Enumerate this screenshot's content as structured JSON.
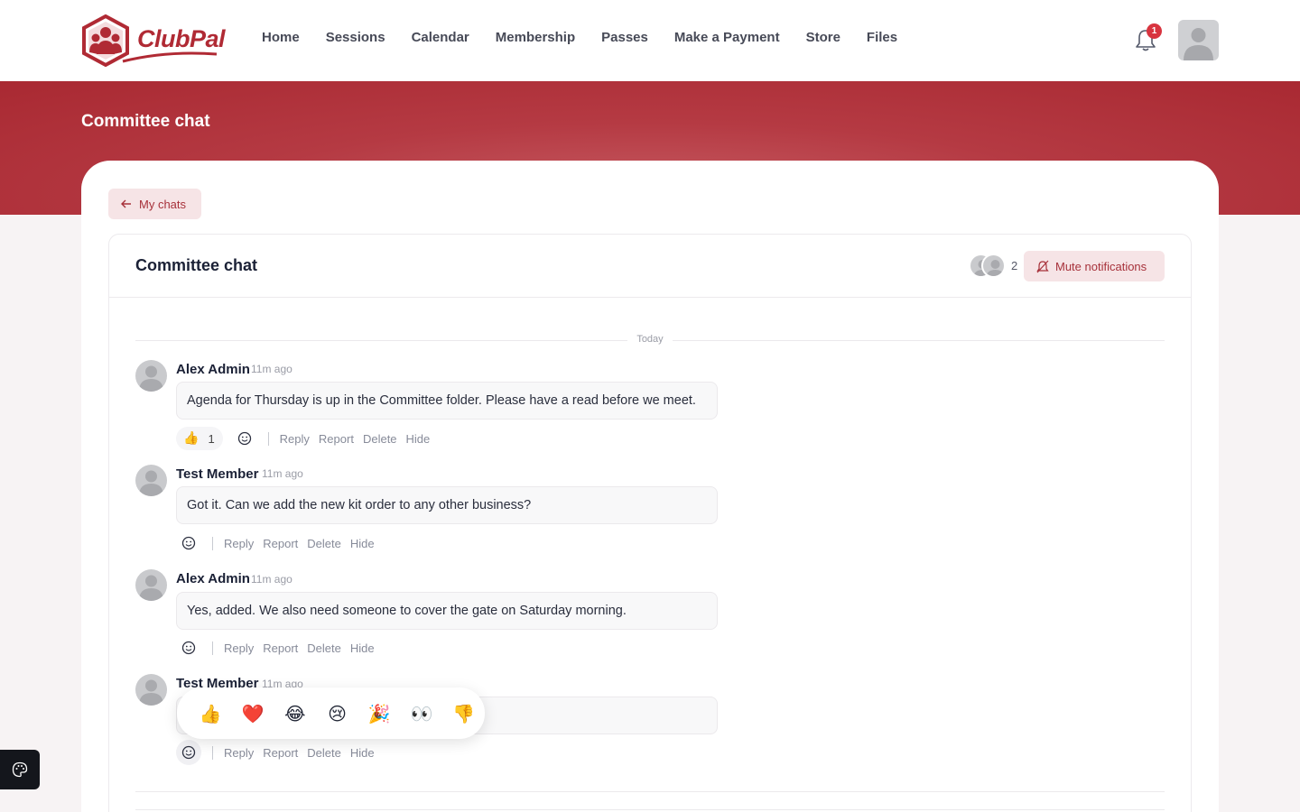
{
  "brand": {
    "name": "ClubPal",
    "accent": "#b02a34"
  },
  "nav": {
    "items": [
      "Home",
      "Sessions",
      "Calendar",
      "Membership",
      "Passes",
      "Make a Payment",
      "Store",
      "Files"
    ]
  },
  "notifications": {
    "count": "1"
  },
  "hero": {
    "title": "Committee chat"
  },
  "back": {
    "label": "My chats"
  },
  "chat": {
    "title": "Committee chat",
    "member_count": "2",
    "mute_label": "Mute notifications",
    "day_divider": "Today"
  },
  "messages": [
    {
      "author": "Alex Admin",
      "time": "11m ago",
      "text": "Agenda for Thursday is up in the Committee folder. Please have a read before we meet.",
      "reaction": {
        "emoji": "👍",
        "count": "1"
      }
    },
    {
      "author": "Test Member",
      "time": "11m ago",
      "text": "Got it. Can we add the new kit order to any other business?"
    },
    {
      "author": "Alex Admin",
      "time": "11m ago",
      "text": "Yes, added. We also need someone to cover the gate on Saturday morning."
    },
    {
      "author": "Test Member",
      "time": "11m ago",
      "text": ""
    }
  ],
  "actions": {
    "reply": "Reply",
    "report": "Report",
    "delete": "Delete",
    "hide": "Hide"
  },
  "emoji_picker": [
    "👍",
    "❤️",
    "😂",
    "😢",
    "🎉",
    "👀",
    "👎"
  ],
  "icons": {
    "bell": "bell-icon",
    "back": "arrow-left-icon",
    "mute": "bell-off-icon",
    "smile": "smile-icon",
    "theme": "palette-icon"
  }
}
